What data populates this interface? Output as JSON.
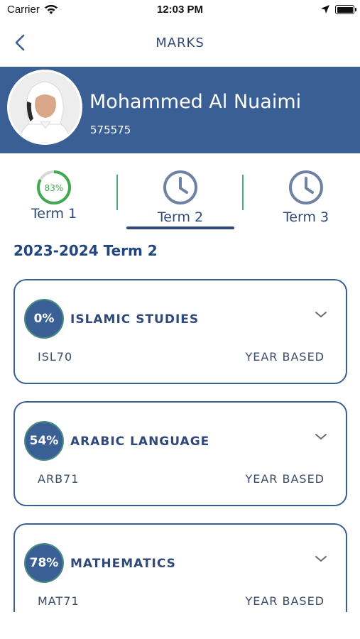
{
  "status_bar": {
    "carrier": "Carrier",
    "time": "12:03 PM"
  },
  "nav": {
    "title": "MARKS",
    "back_icon": "chevron-left-icon"
  },
  "profile": {
    "name": "Mohammed Al Nuaimi",
    "id": "575575"
  },
  "terms": [
    {
      "label": "Term 1",
      "progress_label": "83%",
      "progress": 0.83,
      "icon": "progress-ring-icon",
      "selected": false
    },
    {
      "label": "Term 2",
      "icon": "clock-icon",
      "selected": true
    },
    {
      "label": "Term 3",
      "icon": "clock-icon",
      "selected": false
    }
  ],
  "section_title": "2023-2024 Term 2",
  "subjects": [
    {
      "percent": "0%",
      "name": "ISLAMIC STUDIES",
      "code": "ISL70",
      "basis": "YEAR BASED"
    },
    {
      "percent": "54%",
      "name": "ARABIC LANGUAGE",
      "code": "ARB71",
      "basis": "YEAR BASED"
    },
    {
      "percent": "78%",
      "name": "MATHEMATICS",
      "code": "MAT71",
      "basis": "YEAR BASED"
    }
  ],
  "colors": {
    "primary": "#3a5f95",
    "accent_green": "#4caf50",
    "text": "#2f4a7a"
  }
}
